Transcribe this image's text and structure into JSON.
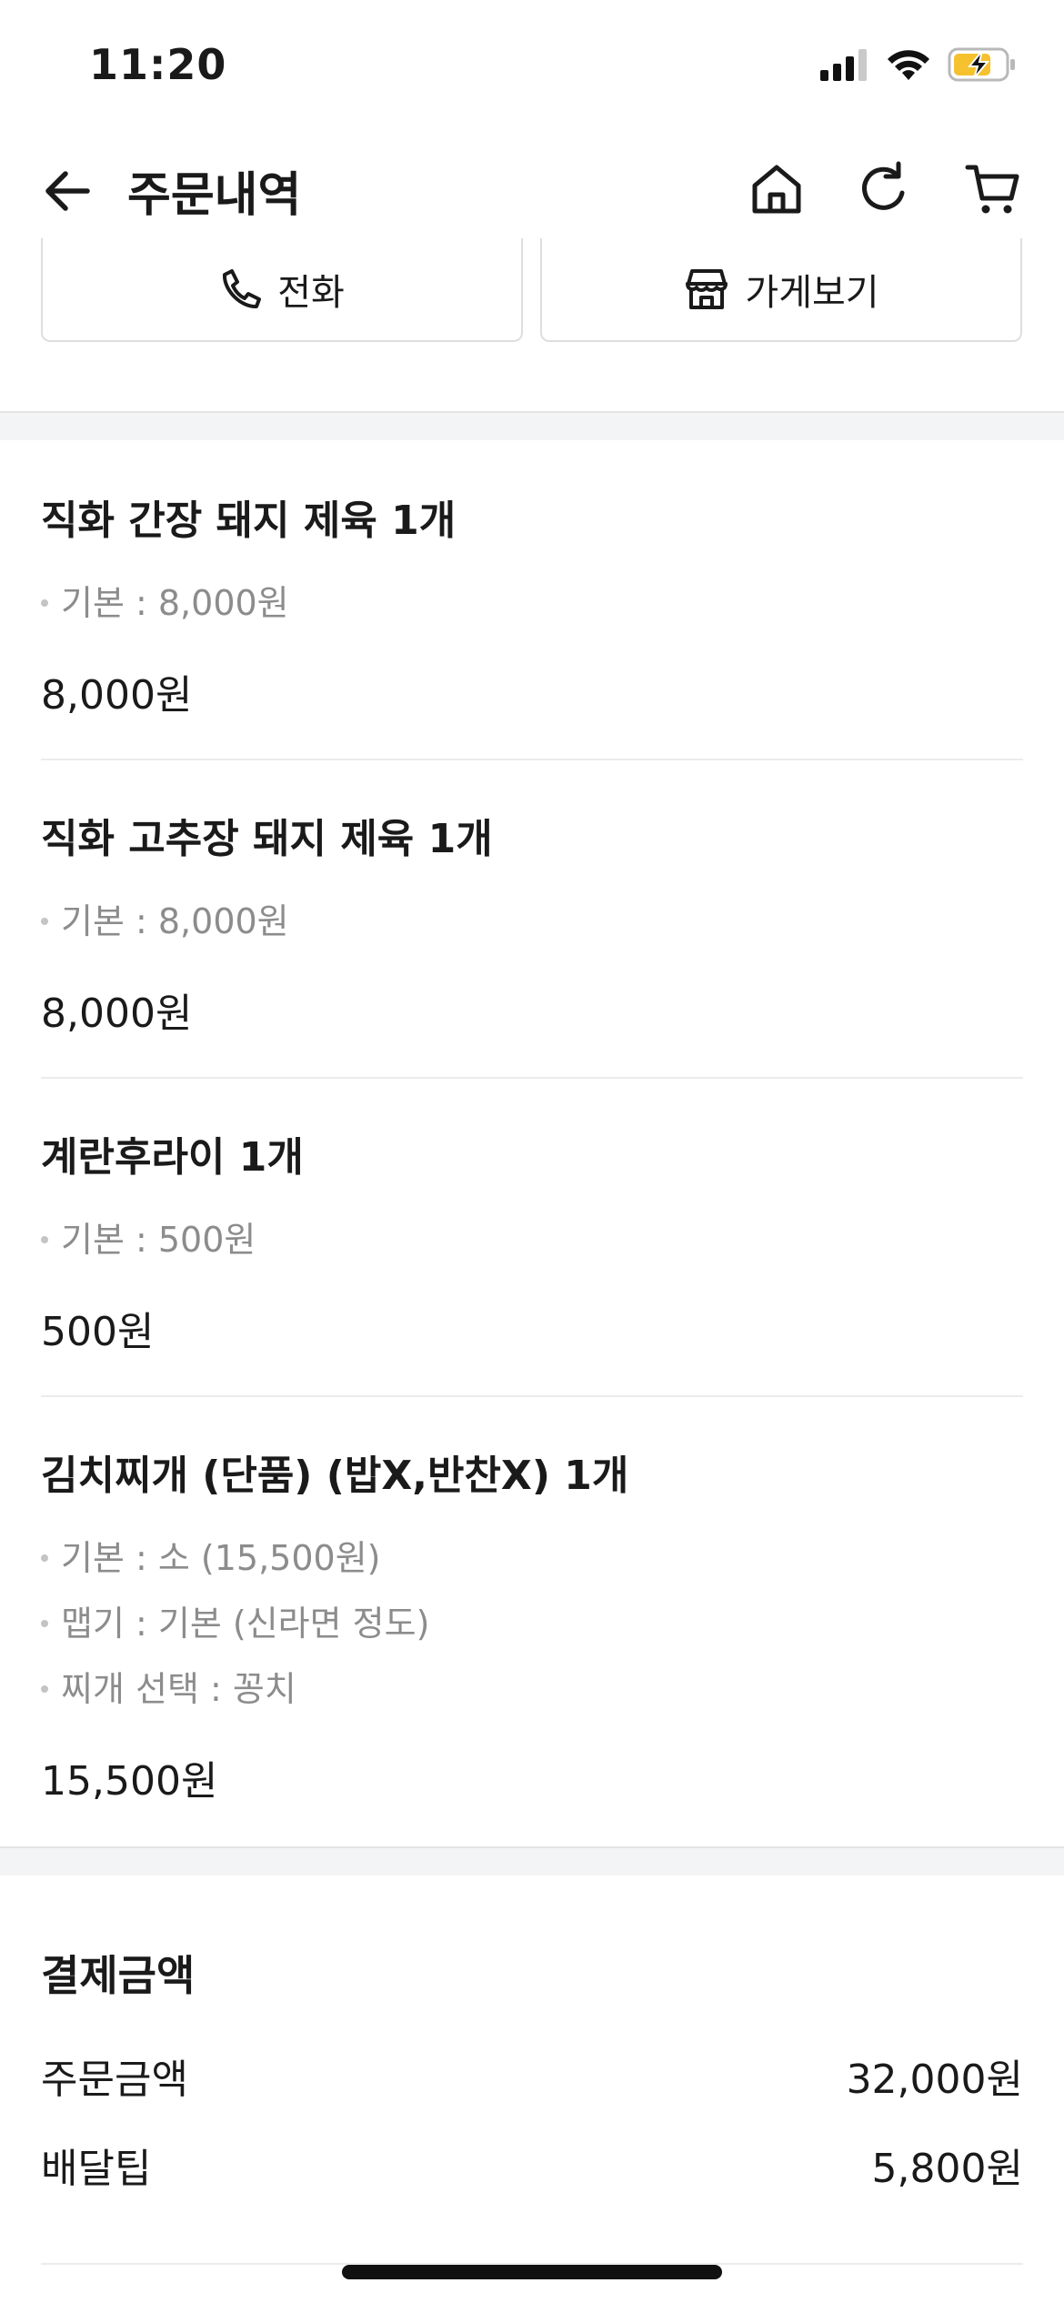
{
  "status_bar": {
    "time": "11:20"
  },
  "nav": {
    "title": "주문내역"
  },
  "top_buttons": {
    "call_label": "전화",
    "store_label": "가게보기"
  },
  "items": [
    {
      "title": "직화 간장 돼지 제육 1개",
      "options": [
        "기본 : 8,000원"
      ],
      "price": "8,000원"
    },
    {
      "title": "직화 고추장 돼지 제육 1개",
      "options": [
        "기본 : 8,000원"
      ],
      "price": "8,000원"
    },
    {
      "title": "계란후라이 1개",
      "options": [
        "기본 : 500원"
      ],
      "price": "500원"
    },
    {
      "title": "김치찌개 (단품) (밥X,반찬X) 1개",
      "options": [
        "기본 : 소 (15,500원)",
        "맵기 : 기본 (신라면 정도)",
        "찌개 선택 : 꽁치"
      ],
      "price": "15,500원"
    }
  ],
  "payment": {
    "title": "결제금액",
    "order_amount_label": "주문금액",
    "order_amount_value": "32,000원",
    "delivery_tip_label": "배달팁",
    "delivery_tip_value": "5,800원"
  },
  "colors": {
    "battery_charging": "#f5c12e",
    "text": "#1a1a1a",
    "muted": "#8c8c8c"
  }
}
